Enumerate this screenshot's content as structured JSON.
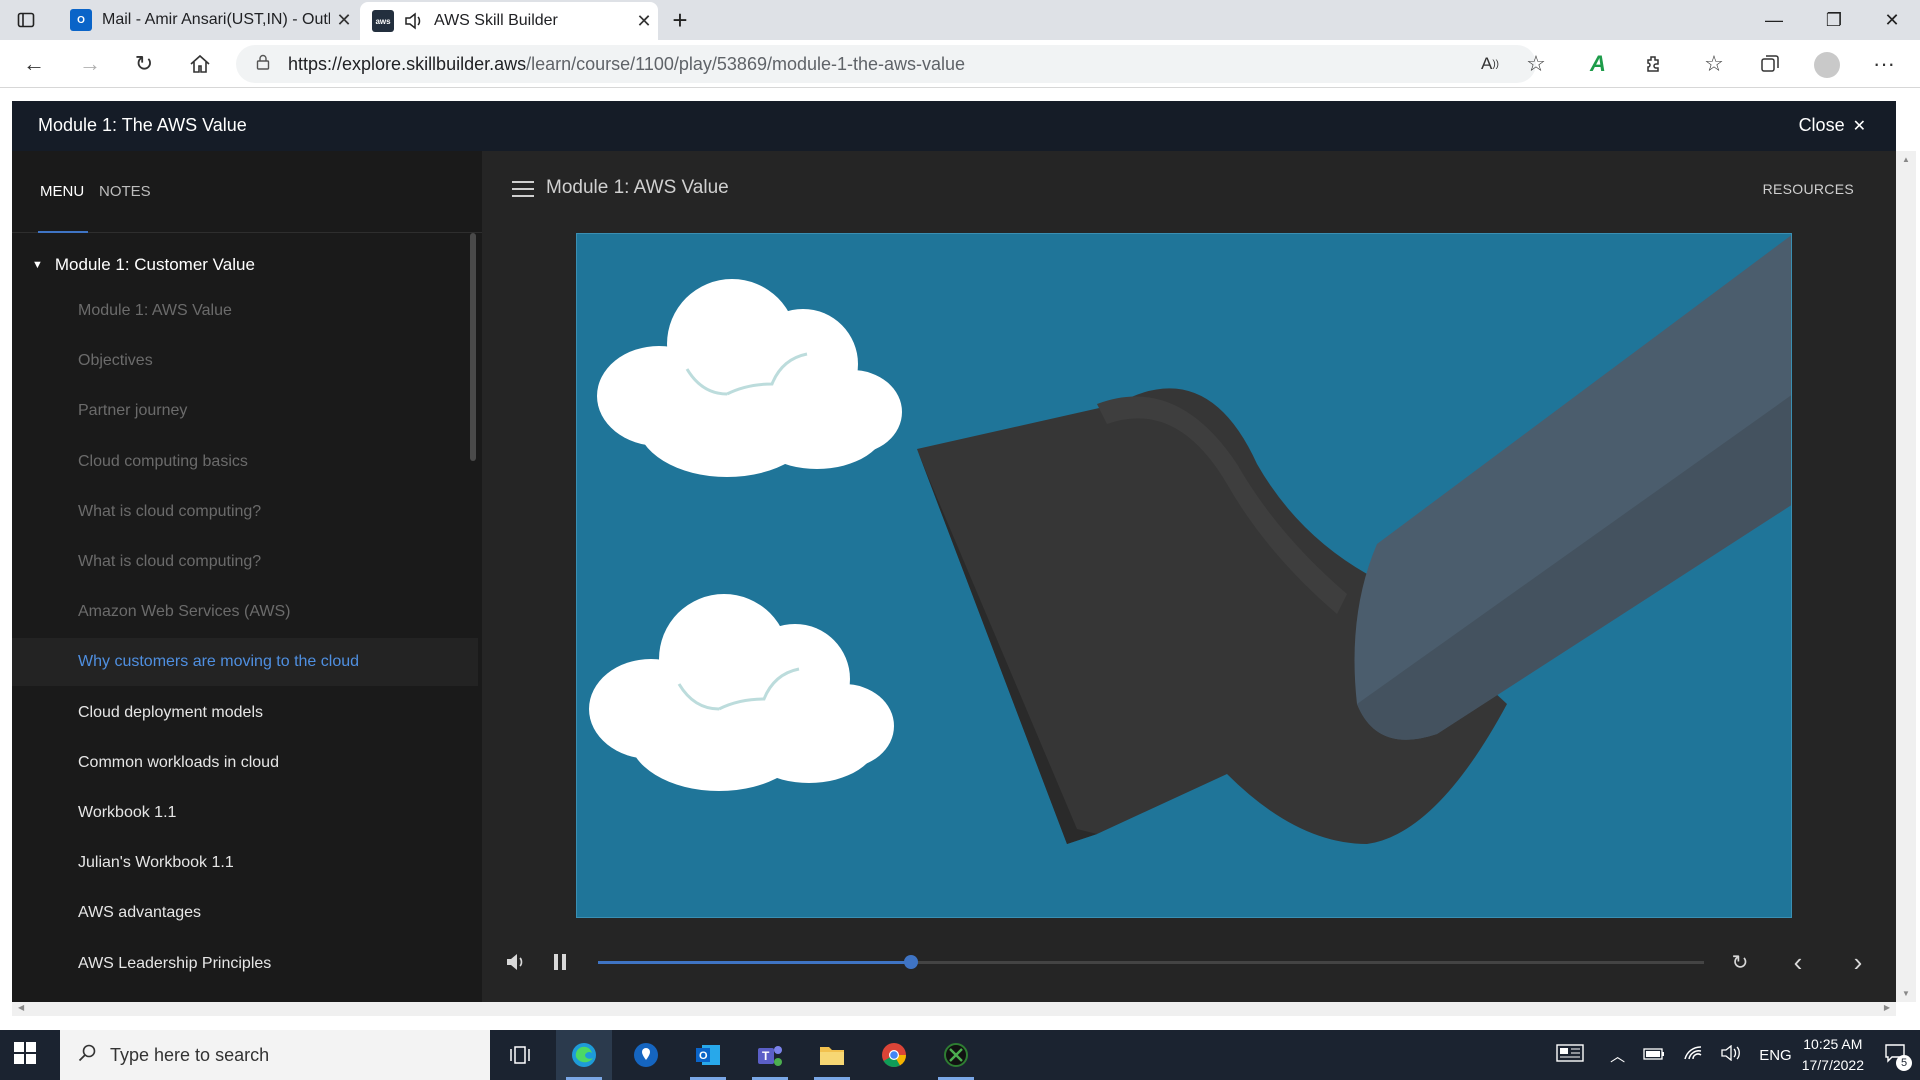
{
  "browser": {
    "tabs": [
      {
        "title": "Mail - Amir Ansari(UST,IN) - Outl",
        "favicon": "outlook-icon",
        "active": false
      },
      {
        "title": "AWS Skill Builder",
        "favicon": "aws-icon",
        "active": true
      }
    ],
    "url_host": "https://explore.skillbuilder.aws",
    "url_path": "/learn/course/1100/play/53869/module-1-the-aws-value"
  },
  "app": {
    "module_title": "Module 1: The AWS Value",
    "close_label": "Close",
    "sidebar": {
      "tab_menu": "MENU",
      "tab_notes": "NOTES",
      "section_title": "Module 1: Customer Value",
      "lessons": [
        {
          "label": "Module 1: AWS Value",
          "state": "done"
        },
        {
          "label": "Objectives",
          "state": "done"
        },
        {
          "label": "Partner journey",
          "state": "done"
        },
        {
          "label": "Cloud computing basics",
          "state": "done"
        },
        {
          "label": "What is cloud computing?",
          "state": "done"
        },
        {
          "label": "What is cloud computing?",
          "state": "done"
        },
        {
          "label": "Amazon Web Services (AWS)",
          "state": "done"
        },
        {
          "label": "Why customers are moving to the cloud",
          "state": "current"
        },
        {
          "label": "Cloud deployment models",
          "state": "todo"
        },
        {
          "label": "Common workloads in cloud",
          "state": "todo"
        },
        {
          "label": "Workbook 1.1",
          "state": "todo"
        },
        {
          "label": "Julian's Workbook 1.1",
          "state": "todo"
        },
        {
          "label": "AWS advantages",
          "state": "todo"
        },
        {
          "label": "AWS Leadership Principles",
          "state": "todo"
        }
      ]
    },
    "lesson_title": "Module 1: AWS Value",
    "resources_label": "RESOURCES",
    "player": {
      "progress": 0.283,
      "playing": true
    }
  },
  "taskbar": {
    "search_placeholder": "Type here to search",
    "language": "ENG",
    "time": "10:25 AM",
    "date": "17/7/2022",
    "notification_count": "5"
  },
  "colors": {
    "accent": "#3f74c4",
    "current_lesson": "#4f8fe0",
    "video_bg": "#1f7599"
  }
}
